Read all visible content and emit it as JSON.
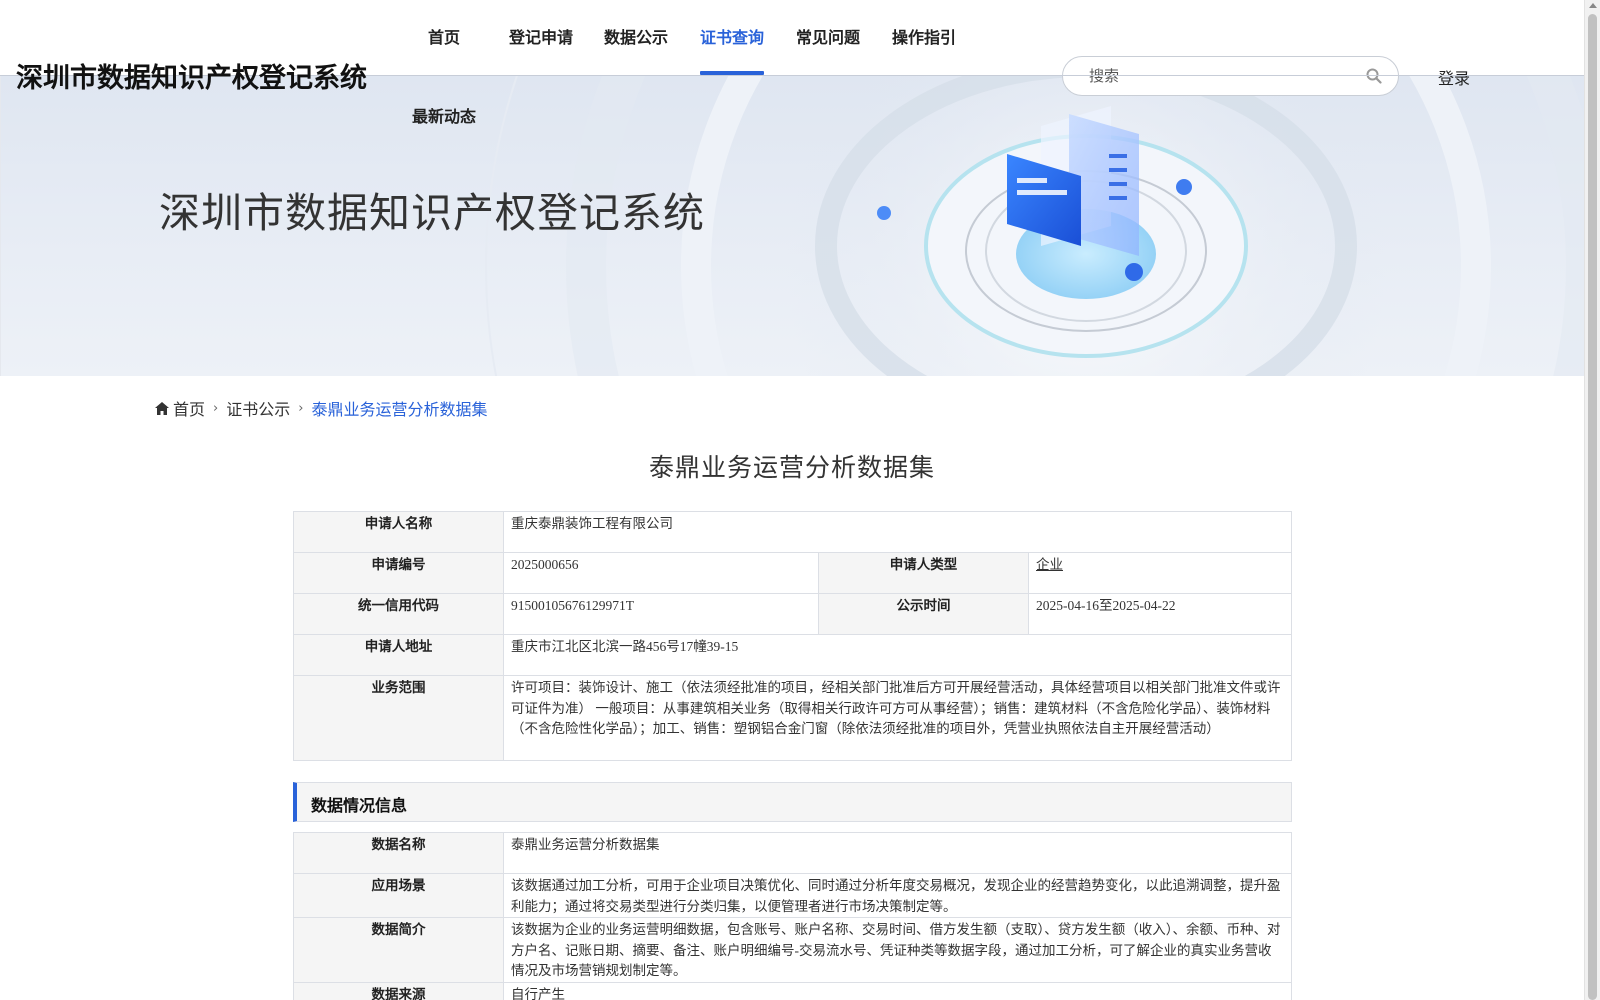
{
  "header": {
    "site_title": "深圳市数据知识产权登记系统",
    "nav": [
      {
        "label": "首页"
      },
      {
        "label": "登记申请"
      },
      {
        "label": "数据公示"
      },
      {
        "label": "证书查询",
        "active": true
      },
      {
        "label": "常见问题"
      },
      {
        "label": "操作指引"
      }
    ],
    "nav_second": "最新动态",
    "search_placeholder": "搜索",
    "login": "登录"
  },
  "banner": {
    "title": "深圳市数据知识产权登记系统"
  },
  "breadcrumb": {
    "items": [
      "首页",
      "证书公示",
      "泰鼎业务运营分析数据集"
    ]
  },
  "title": "泰鼎业务运营分析数据集",
  "applicant": {
    "name_label": "申请人名称",
    "name": "重庆泰鼎装饰工程有限公司",
    "number_label": "申请编号",
    "number": "2025000656",
    "type_label": "申请人类型",
    "type": "企业",
    "credit_code_label": "统一信用代码",
    "credit_code": "91500105676129971T",
    "publish_time_label": "公示时间",
    "publish_time": "2025-04-16至2025-04-22",
    "address_label": "申请人地址",
    "address": "重庆市江北区北滨一路456号17幢39-15",
    "scope_label": "业务范围",
    "scope": "许可项目：装饰设计、施工（依法须经批准的项目，经相关部门批准后方可开展经营活动，具体经营项目以相关部门批准文件或许可证件为准） 一般项目：从事建筑相关业务（取得相关行政许可方可从事经营）；销售：建筑材料（不含危险化学品）、装饰材料（不含危险性化学品）；加工、销售：塑钢铝合金门窗（除依法须经批准的项目外，凭营业执照依法自主开展经营活动）"
  },
  "data_section": {
    "heading": "数据情况信息",
    "rows": [
      {
        "label": "数据名称",
        "value": "泰鼎业务运营分析数据集"
      },
      {
        "label": "应用场景",
        "value": "该数据通过加工分析，可用于企业项目决策优化、同时通过分析年度交易概况，发现企业的经营趋势变化，以此追溯调整，提升盈利能力；通过将交易类型进行分类归集，以便管理者进行市场决策制定等。"
      },
      {
        "label": "数据简介",
        "value": "该数据为企业的业务运营明细数据，包含账号、账户名称、交易时间、借方发生额（支取）、贷方发生额（收入）、余额、币种、对方户名、记账日期、摘要、备注、账户明细编号-交易流水号、凭证种类等数据字段，通过加工分析，可了解企业的真实业务营收情况及市场营销规划制定等。"
      },
      {
        "label": "数据来源",
        "value": "自行产生"
      }
    ]
  },
  "colors": {
    "accent": "#2962d9",
    "label_bg": "#f5f5f5",
    "border": "#dcdfe5"
  }
}
